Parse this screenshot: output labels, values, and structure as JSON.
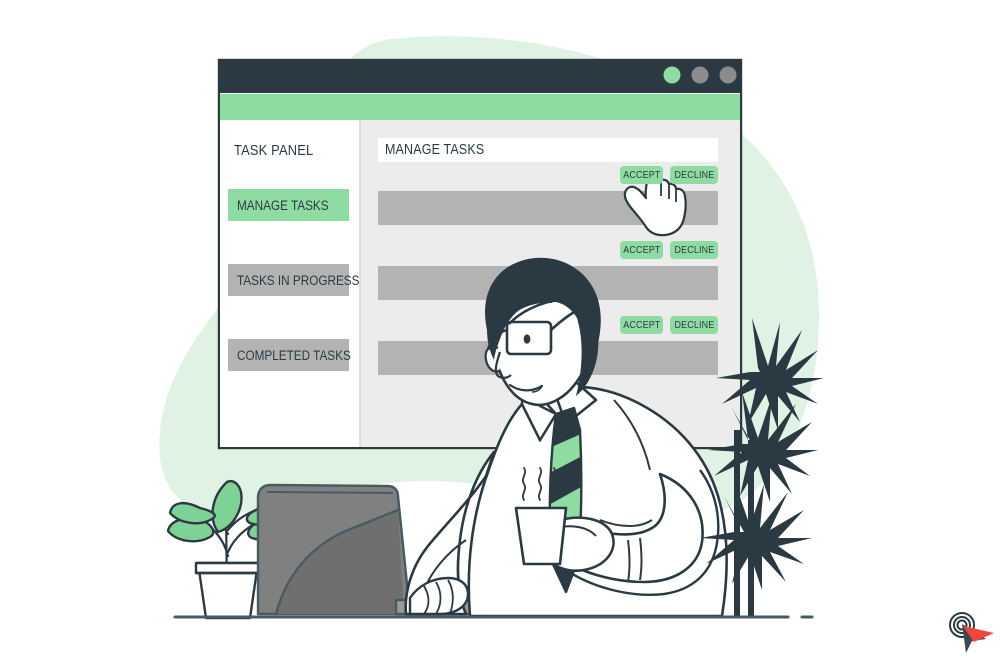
{
  "illustration": {
    "kind": "flat-vector-illustration",
    "subject": "man-at-desk-with-laptop-managing-tasks",
    "palette": {
      "green_accent": "#8edca1",
      "green_blob": "#dff2e3",
      "dark_ink": "#2b3a42",
      "titlebar": "#2b3a42",
      "panel_bg": "#ececec",
      "bar_gray": "#b3b3b3",
      "sidebar_bg": "#ffffff",
      "laptop_gray": "#808080",
      "laptop_gray_dark": "#6e6e6e",
      "cursor_red": "#f4453c",
      "white": "#ffffff"
    }
  },
  "window": {
    "titlebar": {
      "dots": [
        {
          "name": "dot-green",
          "color": "#8edca1"
        },
        {
          "name": "dot-gray-1",
          "color": "#8c8c8c"
        },
        {
          "name": "dot-gray-2",
          "color": "#8c8c8c"
        }
      ]
    },
    "sidebar": {
      "heading": "TASK PANEL",
      "items": [
        {
          "label": "MANAGE TASKS",
          "state": "active"
        },
        {
          "label": "TASKS IN PROGRESS",
          "state": "inactive"
        },
        {
          "label": "COMPLETED TASKS",
          "state": "inactive"
        }
      ]
    },
    "content": {
      "title": "MANAGE TASKS",
      "rows": [
        {
          "accept_label": "ACCEPT",
          "decline_label": "DECLINE"
        },
        {
          "accept_label": "ACCEPT",
          "decline_label": "DECLINE"
        },
        {
          "accept_label": "ACCEPT",
          "decline_label": "DECLINE"
        }
      ]
    }
  },
  "overlays": {
    "hand_cursor": "pointing-hand-cursor",
    "target_cursor": "target-arrow-cursor"
  },
  "scene_objects": [
    "green-background-blob",
    "browser-window",
    "potted-plant-left",
    "laptop",
    "man-with-glasses",
    "striped-necktie",
    "coffee-mug-with-steam",
    "palm-plant-right",
    "desk-line"
  ]
}
